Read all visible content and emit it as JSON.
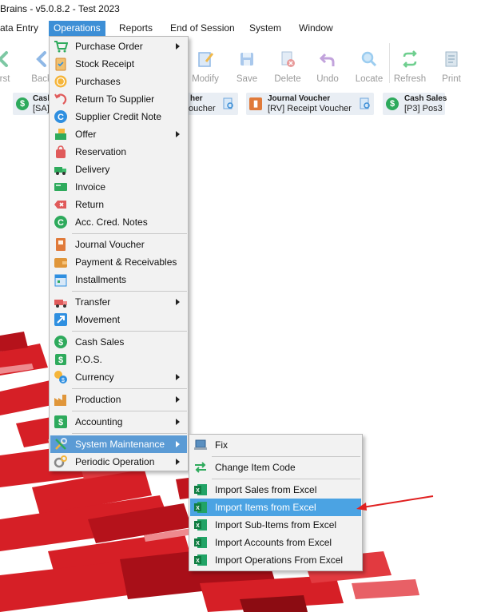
{
  "window": {
    "title": "Brains - v5.0.8.2 - Test 2023"
  },
  "menubar": {
    "items": [
      "ata Entry",
      "Operations",
      "Reports",
      "End of Session",
      "System",
      "Window"
    ]
  },
  "toolbar": {
    "buttons": [
      {
        "label": "rst",
        "icon": "first-icon",
        "color": "#7ec8a4"
      },
      {
        "label": "Back",
        "icon": "back-arrow-icon",
        "color": "#8fb8e6"
      },
      {
        "label": "Modify",
        "icon": "modify-icon",
        "color": "#8fb8e6"
      },
      {
        "label": "Save",
        "icon": "save-icon",
        "color": "#8fb8e6"
      },
      {
        "label": "Delete",
        "icon": "delete-icon",
        "color": "#e89a9a"
      },
      {
        "label": "Undo",
        "icon": "undo-icon",
        "color": "#c2a3dc"
      },
      {
        "label": "Locate",
        "icon": "locate-icon",
        "color": "#9ccdf0"
      },
      {
        "label": "Refresh",
        "icon": "refresh-icon",
        "color": "#6fcf8f"
      },
      {
        "label": "Print",
        "icon": "print-icon",
        "color": "#9fb7c8"
      }
    ]
  },
  "shortcuts": [
    {
      "title": "Cash",
      "subtitle": "[SA]",
      "icon": "dollar-icon",
      "color": "#2eaa5c"
    },
    {
      "title": "her",
      "subtitle": "oucher",
      "icon": "document-icon",
      "color": "#3d8fd6"
    },
    {
      "title": "Journal Voucher",
      "subtitle": "[RV] Receipt Voucher",
      "icon": "journal-icon",
      "color": "#e07a3a"
    },
    {
      "title": "Cash Sales",
      "subtitle": "[P3] Pos3",
      "icon": "dollar-icon",
      "color": "#2eaa5c"
    }
  ],
  "operations_menu": {
    "items": [
      {
        "label": "Purchase Order",
        "icon": "cart-icon",
        "color": "#2eaa5c",
        "submenu": true
      },
      {
        "label": "Stock Receipt",
        "icon": "clipboard-icon",
        "color": "#d98a2b",
        "submenu": false
      },
      {
        "label": "Purchases",
        "icon": "coin-icon",
        "color": "#f0a53a",
        "submenu": false
      },
      {
        "label": "Return To Supplier",
        "icon": "return-icon",
        "color": "#e05a5a",
        "submenu": false
      },
      {
        "label": "Supplier Credit Note",
        "icon": "credit-c-icon",
        "color": "#2f8fe0",
        "submenu": false
      },
      {
        "label": "Offer",
        "icon": "offer-icon",
        "color": "#2eaa5c",
        "submenu": true
      },
      {
        "label": "Reservation",
        "icon": "bag-icon",
        "color": "#e05a5a",
        "submenu": false
      },
      {
        "label": "Delivery",
        "icon": "delivery-icon",
        "color": "#2eaa5c",
        "submenu": false
      },
      {
        "label": "Invoice",
        "icon": "invoice-icon",
        "color": "#2eaa5c",
        "submenu": false
      },
      {
        "label": "Return",
        "icon": "return-x-icon",
        "color": "#e05a5a",
        "submenu": false
      },
      {
        "label": "Acc. Cred. Notes",
        "icon": "credit-c-icon",
        "color": "#2eaa5c",
        "submenu": false
      },
      {
        "label": "Journal Voucher",
        "icon": "journal-icon",
        "color": "#e07a3a",
        "submenu": false
      },
      {
        "label": "Payment & Receivables",
        "icon": "wallet-icon",
        "color": "#e0963a",
        "submenu": false
      },
      {
        "label": "Installments",
        "icon": "calendar-icon",
        "color": "#2f8fe0",
        "submenu": false
      },
      {
        "label": "Transfer",
        "icon": "truck-icon",
        "color": "#e05a5a",
        "submenu": true
      },
      {
        "label": "Movement",
        "icon": "movement-icon",
        "color": "#2f8fe0",
        "submenu": false
      },
      {
        "label": "Cash Sales",
        "icon": "dollar-icon",
        "color": "#2eaa5c",
        "submenu": false
      },
      {
        "label": "P.O.S.",
        "icon": "pos-icon",
        "color": "#2eaa5c",
        "submenu": false
      },
      {
        "label": "Currency",
        "icon": "currency-icon",
        "color": "#e0a53a",
        "submenu": true
      },
      {
        "label": "Production",
        "icon": "factory-icon",
        "color": "#e0963a",
        "submenu": true
      },
      {
        "label": "Accounting",
        "icon": "dollar-square-icon",
        "color": "#2eaa5c",
        "submenu": true
      },
      {
        "label": "System Maintenance",
        "icon": "tools-icon",
        "color": "#2f8fe0",
        "submenu": true
      },
      {
        "label": "Periodic Operation",
        "icon": "gears-icon",
        "color": "#888888",
        "submenu": true
      }
    ]
  },
  "system_maintenance_menu": {
    "items": [
      {
        "label": "Fix",
        "icon": "laptop-icon"
      },
      {
        "label": "Change Item Code",
        "icon": "swap-arrows-icon"
      },
      {
        "label": "Import Sales from Excel",
        "icon": "excel-icon"
      },
      {
        "label": "Import Items from Excel",
        "icon": "excel-icon"
      },
      {
        "label": "Import Sub-Items from Excel",
        "icon": "excel-icon"
      },
      {
        "label": "Import Accounts from Excel",
        "icon": "excel-icon"
      },
      {
        "label": "Import Operations From Excel",
        "icon": "excel-icon"
      }
    ]
  },
  "colors": {
    "menu_highlight": "#5b9bd5",
    "active_menu": "#3d8fd6",
    "annotation_arrow": "#e02020",
    "excel_green": "#1d7a45",
    "background_red": "#d61f26"
  }
}
